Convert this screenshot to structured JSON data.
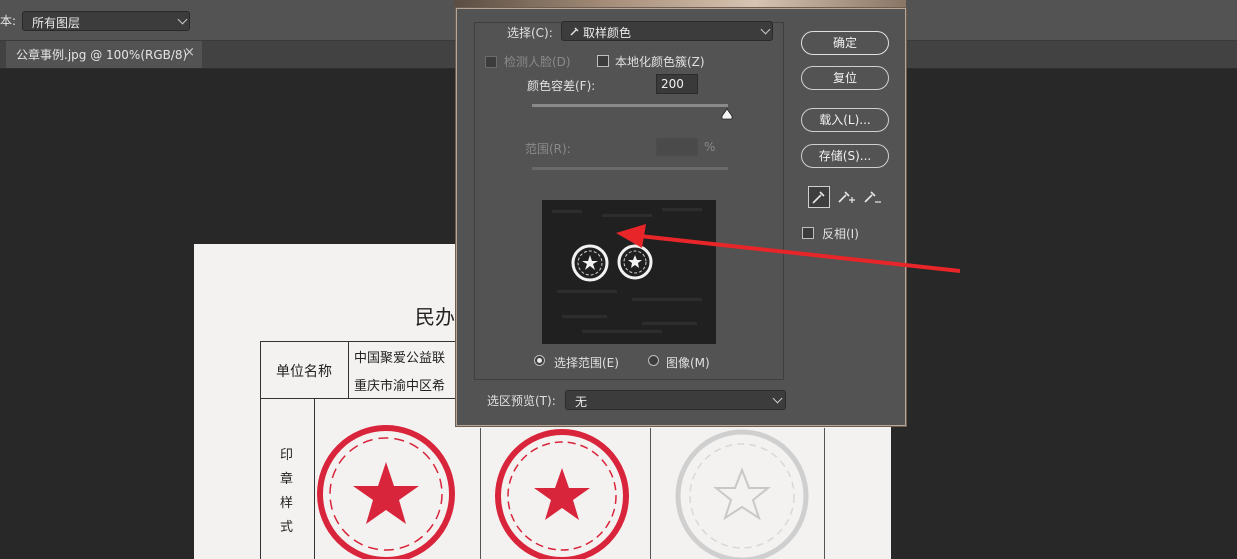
{
  "options_bar": {
    "sample_label": "本:",
    "sample_value": "所有图层"
  },
  "tab": {
    "title": "公章事例.jpg @ 100%(RGB/8)",
    "close": "×"
  },
  "document": {
    "title_partial": "民办",
    "row1_label": "单位名称",
    "row1_value1": "中国聚爱公益联",
    "row1_value2": "重庆市渝中区希",
    "seal_label": [
      "印",
      "章",
      "样",
      "式"
    ],
    "seal_colors": {
      "red": "#d9253b",
      "emboss": "#d4d4d4"
    }
  },
  "dialog": {
    "select_label": "选择(C):",
    "select_value": "取样颜色",
    "detect_faces": "检测人脸(D)",
    "localized": "本地化颜色簇(Z)",
    "fuzziness_label": "颜色容差(F):",
    "fuzziness_value": "200",
    "range_label": "范围(R):",
    "range_unit": "%",
    "radio_selection": "选择范围(E)",
    "radio_image": "图像(M)",
    "preview_label": "选区预览(T):",
    "preview_value": "无",
    "btn_ok": "确定",
    "btn_reset": "复位",
    "btn_load": "载入(L)...",
    "btn_save": "存储(S)...",
    "invert": "反相(I)"
  },
  "colors": {
    "arrow": "#e8262a",
    "accent_border": "#b7a595"
  }
}
